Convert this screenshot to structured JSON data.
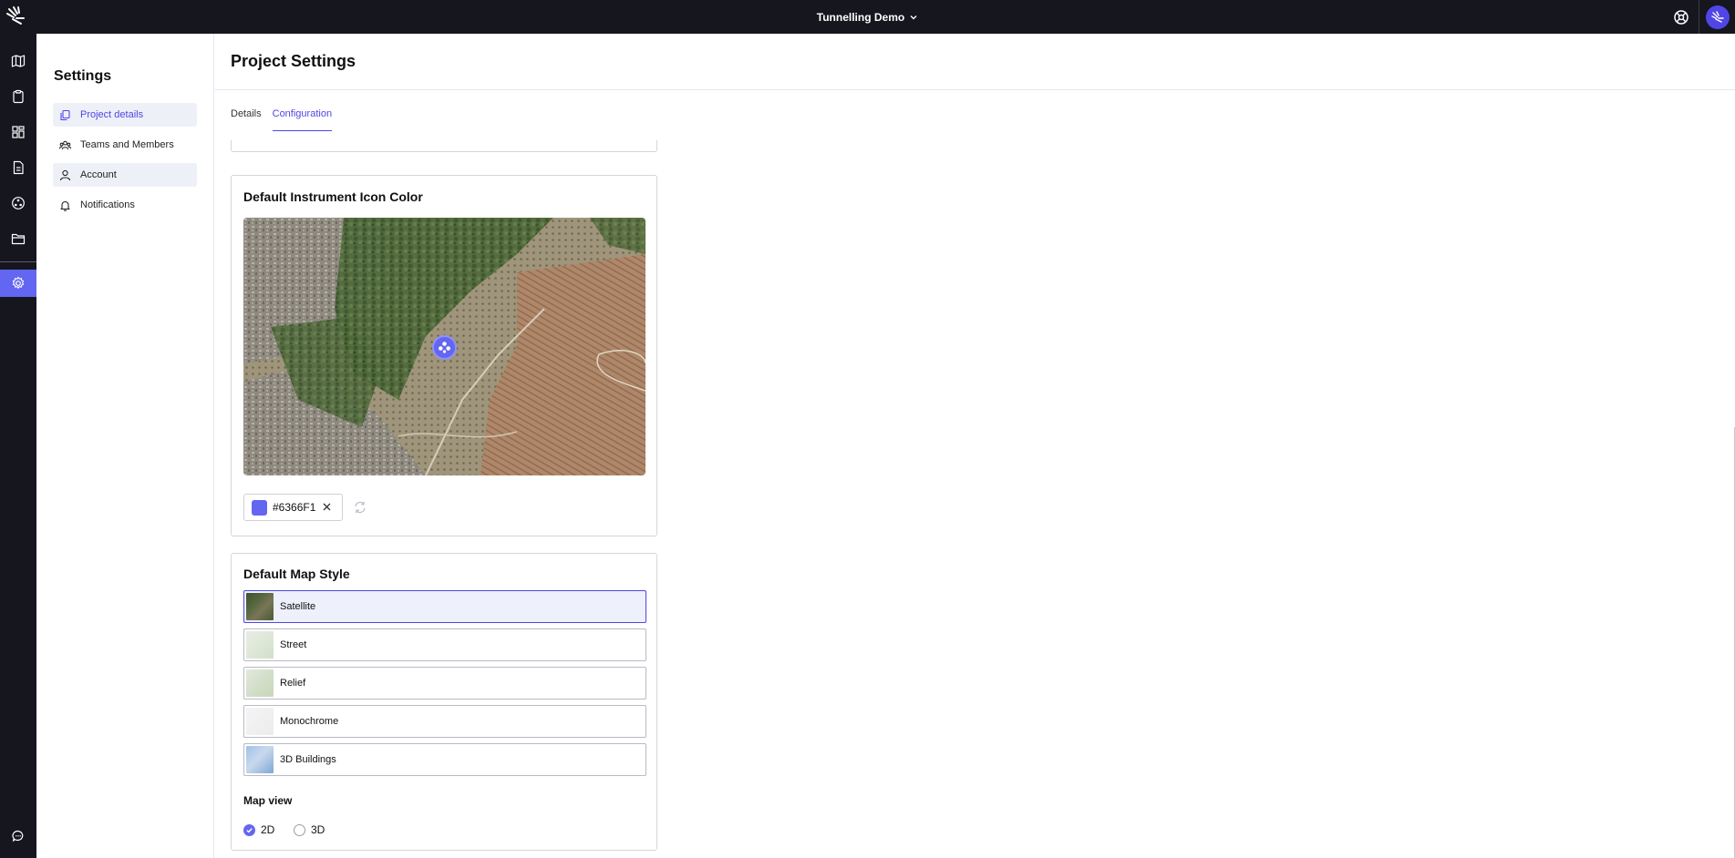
{
  "topbar": {
    "project_name": "Tunnelling Demo"
  },
  "rail": {
    "items": [
      "map-icon",
      "clipboard-icon",
      "dashboard-icon",
      "report-icon",
      "instrument-icon",
      "folder-icon",
      "gear-icon",
      "chat-icon"
    ]
  },
  "sidebar": {
    "title": "Settings",
    "items": [
      {
        "label": "Project details",
        "icon": "copy-icon"
      },
      {
        "label": "Teams and Members",
        "icon": "team-icon"
      },
      {
        "label": "Account",
        "icon": "user-icon"
      },
      {
        "label": "Notifications",
        "icon": "bell-icon"
      }
    ]
  },
  "main": {
    "title": "Project Settings",
    "tabs": [
      {
        "label": "Details"
      },
      {
        "label": "Configuration"
      }
    ],
    "icon_color": {
      "title": "Default Instrument Icon Color",
      "hex": "#6366F1",
      "color": "#6366F1"
    },
    "map_style": {
      "title": "Default Map Style",
      "options": [
        {
          "label": "Satellite",
          "selected": true
        },
        {
          "label": "Street",
          "selected": false
        },
        {
          "label": "Relief",
          "selected": false
        },
        {
          "label": "Monochrome",
          "selected": false
        },
        {
          "label": "3D Buildings",
          "selected": false
        }
      ],
      "map_view_label": "Map view",
      "map_view_options": [
        {
          "label": "2D",
          "checked": true
        },
        {
          "label": "3D",
          "checked": false
        }
      ]
    }
  },
  "colors": {
    "brand_dark": "#15161e",
    "accent": "#6366f1"
  }
}
